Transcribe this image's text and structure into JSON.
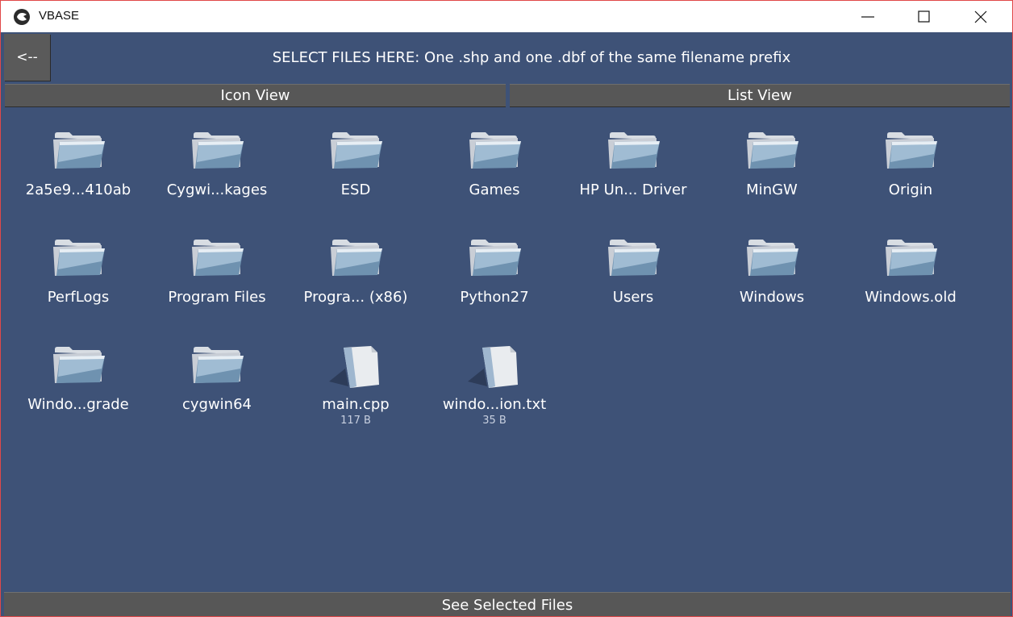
{
  "window": {
    "title": "VBASE"
  },
  "header": {
    "back_label": "<--",
    "instruction": "SELECT FILES HERE: One .shp and one .dbf of the same filename prefix"
  },
  "view_tabs": {
    "icon_view": "Icon View",
    "list_view": "List View"
  },
  "items": [
    {
      "name": "2a5e9...410ab",
      "type": "folder",
      "size": ""
    },
    {
      "name": "Cygwi...kages",
      "type": "folder",
      "size": ""
    },
    {
      "name": "ESD",
      "type": "folder",
      "size": ""
    },
    {
      "name": "Games",
      "type": "folder",
      "size": ""
    },
    {
      "name": "HP Un... Driver",
      "type": "folder",
      "size": ""
    },
    {
      "name": "MinGW",
      "type": "folder",
      "size": ""
    },
    {
      "name": "Origin",
      "type": "folder",
      "size": ""
    },
    {
      "name": "PerfLogs",
      "type": "folder",
      "size": ""
    },
    {
      "name": "Program Files",
      "type": "folder",
      "size": ""
    },
    {
      "name": "Progra... (x86)",
      "type": "folder",
      "size": ""
    },
    {
      "name": "Python27",
      "type": "folder",
      "size": ""
    },
    {
      "name": "Users",
      "type": "folder",
      "size": ""
    },
    {
      "name": "Windows",
      "type": "folder",
      "size": ""
    },
    {
      "name": "Windows.old",
      "type": "folder",
      "size": ""
    },
    {
      "name": "Windo...grade",
      "type": "folder",
      "size": ""
    },
    {
      "name": "cygwin64",
      "type": "folder",
      "size": ""
    },
    {
      "name": "main.cpp",
      "type": "file",
      "size": "117 B"
    },
    {
      "name": "windo...ion.txt",
      "type": "file",
      "size": "35 B"
    }
  ],
  "footer": {
    "see_selected": "See Selected Files"
  },
  "colors": {
    "background": "#3e5277",
    "button": "#575757",
    "text": "#ffffff"
  }
}
